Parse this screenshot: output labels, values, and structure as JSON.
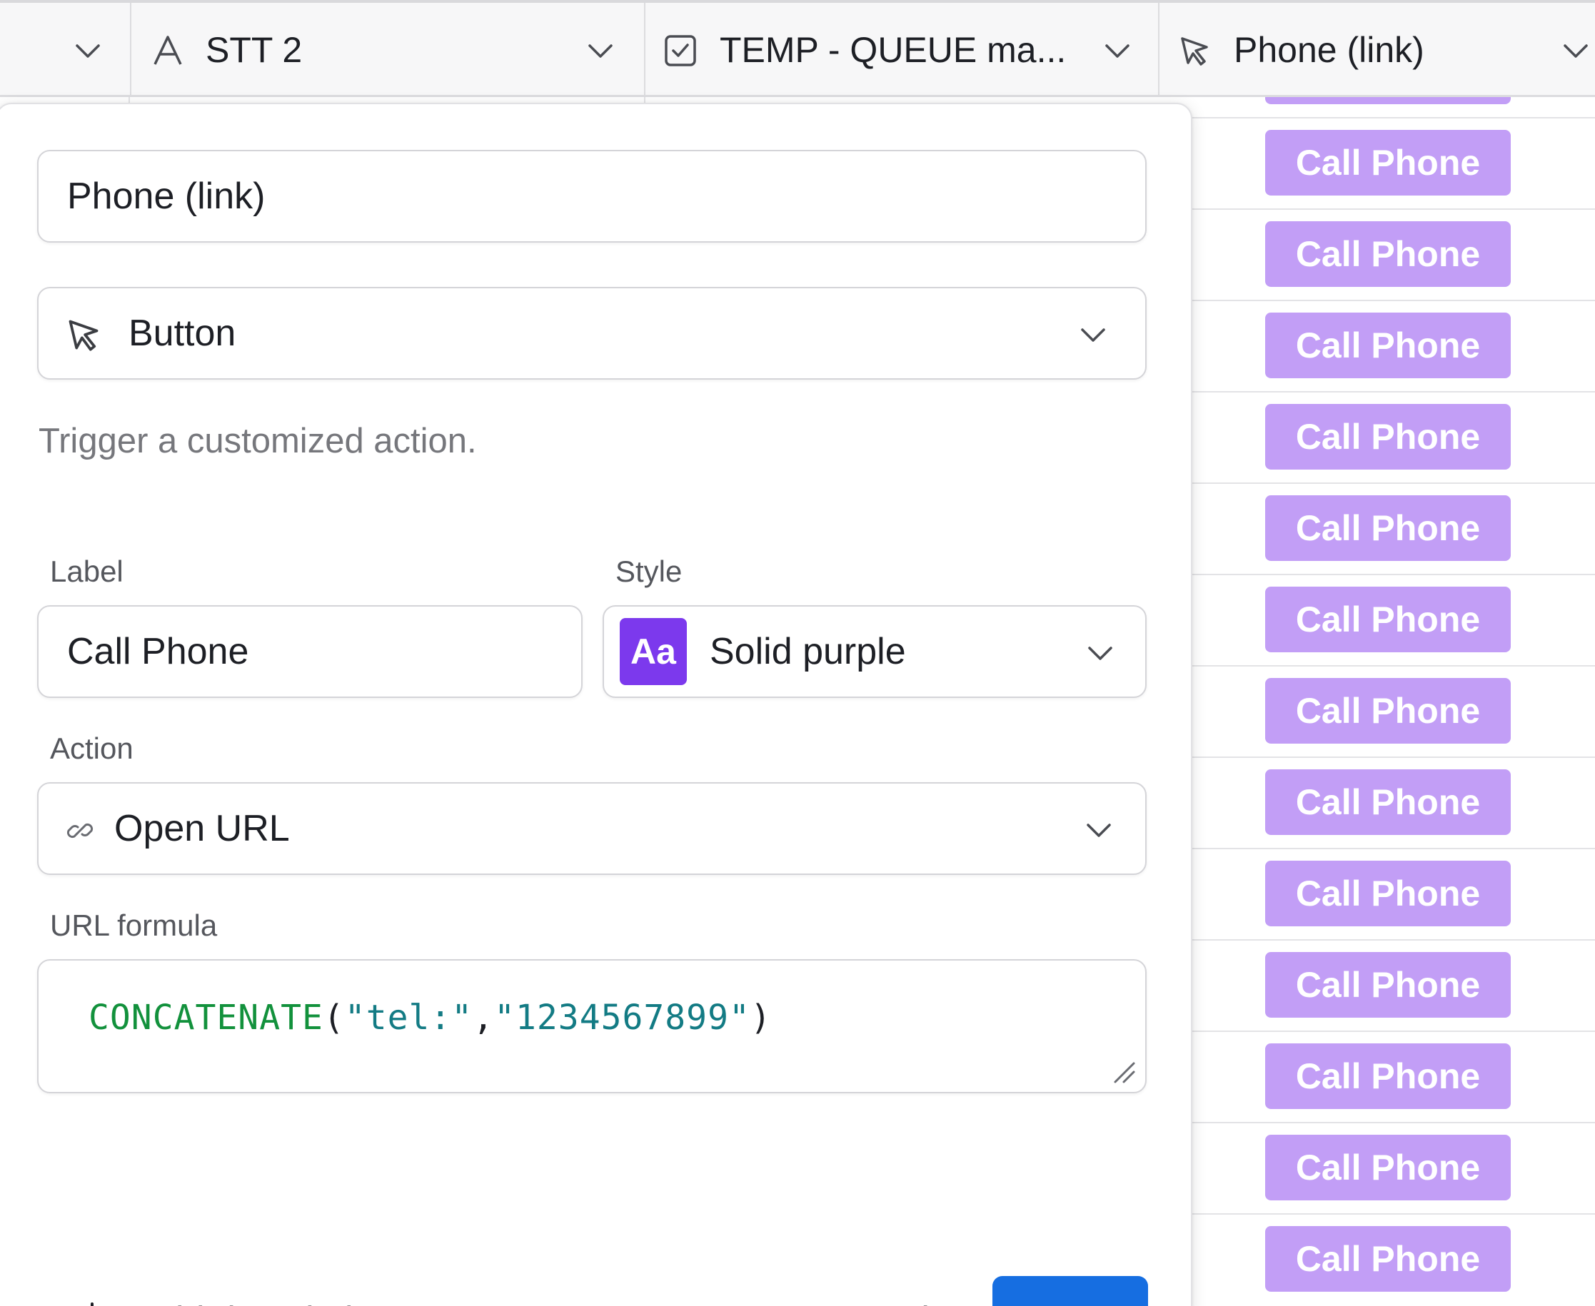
{
  "grid": {
    "columns": [
      {
        "title": "",
        "icon": "chevron-down-icon"
      },
      {
        "title": "STT 2",
        "icon": "text-type-icon"
      },
      {
        "title": "TEMP - QUEUE ma...",
        "icon": "checkbox-icon"
      },
      {
        "title": "Phone (link)",
        "icon": "cursor-icon"
      }
    ],
    "button_cells": [
      "Call Phone",
      "Call Phone",
      "Call Phone",
      "Call Phone",
      "Call Phone",
      "Call Phone",
      "Call Phone",
      "Call Phone",
      "Call Phone",
      "Call Phone",
      "Call Phone",
      "Call Phone",
      "Call Phone"
    ],
    "button_color": "#c29ef6"
  },
  "dialog": {
    "field_name": "Phone (link)",
    "field_type": {
      "label": "Button",
      "icon": "cursor-icon"
    },
    "type_description": "Trigger a customized action.",
    "label_section": {
      "title": "Label",
      "value": "Call Phone"
    },
    "style_section": {
      "title": "Style",
      "swatch_text": "Aa",
      "value": "Solid purple",
      "swatch_color": "#7c39ed"
    },
    "action_section": {
      "title": "Action",
      "value": "Open URL",
      "icon": "link-icon"
    },
    "url_formula_section": {
      "title": "URL formula",
      "formula_func": "CONCATENATE",
      "formula_open": "(",
      "formula_arg1": "\"tel:\"",
      "formula_comma": ",",
      "formula_arg2": "\"1234567899\"",
      "formula_close": ")"
    },
    "footer": {
      "add_description": "Add description",
      "cancel": "Cancel",
      "save": "Save",
      "save_color": "#166ee1"
    }
  }
}
